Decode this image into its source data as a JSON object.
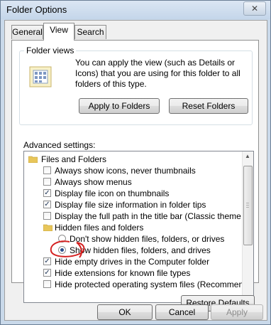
{
  "window": {
    "title": "Folder Options"
  },
  "tabs": [
    {
      "label": "General"
    },
    {
      "label": "View"
    },
    {
      "label": "Search"
    }
  ],
  "folder_views": {
    "title": "Folder views",
    "description": "You can apply the view (such as Details or Icons) that you are using for this folder to all folders of this type.",
    "apply_label": "Apply to Folders",
    "reset_label": "Reset Folders"
  },
  "advanced": {
    "label": "Advanced settings:",
    "items": [
      {
        "kind": "folder",
        "label": "Files and Folders"
      },
      {
        "kind": "checkbox",
        "checked": false,
        "label": "Always show icons, never thumbnails"
      },
      {
        "kind": "checkbox",
        "checked": false,
        "label": "Always show menus"
      },
      {
        "kind": "checkbox",
        "checked": true,
        "label": "Display file icon on thumbnails"
      },
      {
        "kind": "checkbox",
        "checked": true,
        "label": "Display file size information in folder tips"
      },
      {
        "kind": "checkbox",
        "checked": false,
        "label": "Display the full path in the title bar (Classic theme only)"
      },
      {
        "kind": "folder",
        "label": "Hidden files and folders"
      },
      {
        "kind": "radio",
        "selected": false,
        "label": "Don't show hidden files, folders, or drives"
      },
      {
        "kind": "radio",
        "selected": true,
        "label": "Show hidden files, folders, and drives"
      },
      {
        "kind": "checkbox",
        "checked": true,
        "label": "Hide empty drives in the Computer folder"
      },
      {
        "kind": "checkbox",
        "checked": true,
        "label": "Hide extensions for known file types"
      },
      {
        "kind": "checkbox",
        "checked": false,
        "label": "Hide protected operating system files (Recommended)"
      }
    ]
  },
  "restore_defaults_label": "Restore Defaults",
  "footer": {
    "ok_label": "OK",
    "cancel_label": "Cancel",
    "apply_label": "Apply"
  },
  "colors": {
    "annotation": "#d42020",
    "window_frame": "#c9d9ea"
  }
}
